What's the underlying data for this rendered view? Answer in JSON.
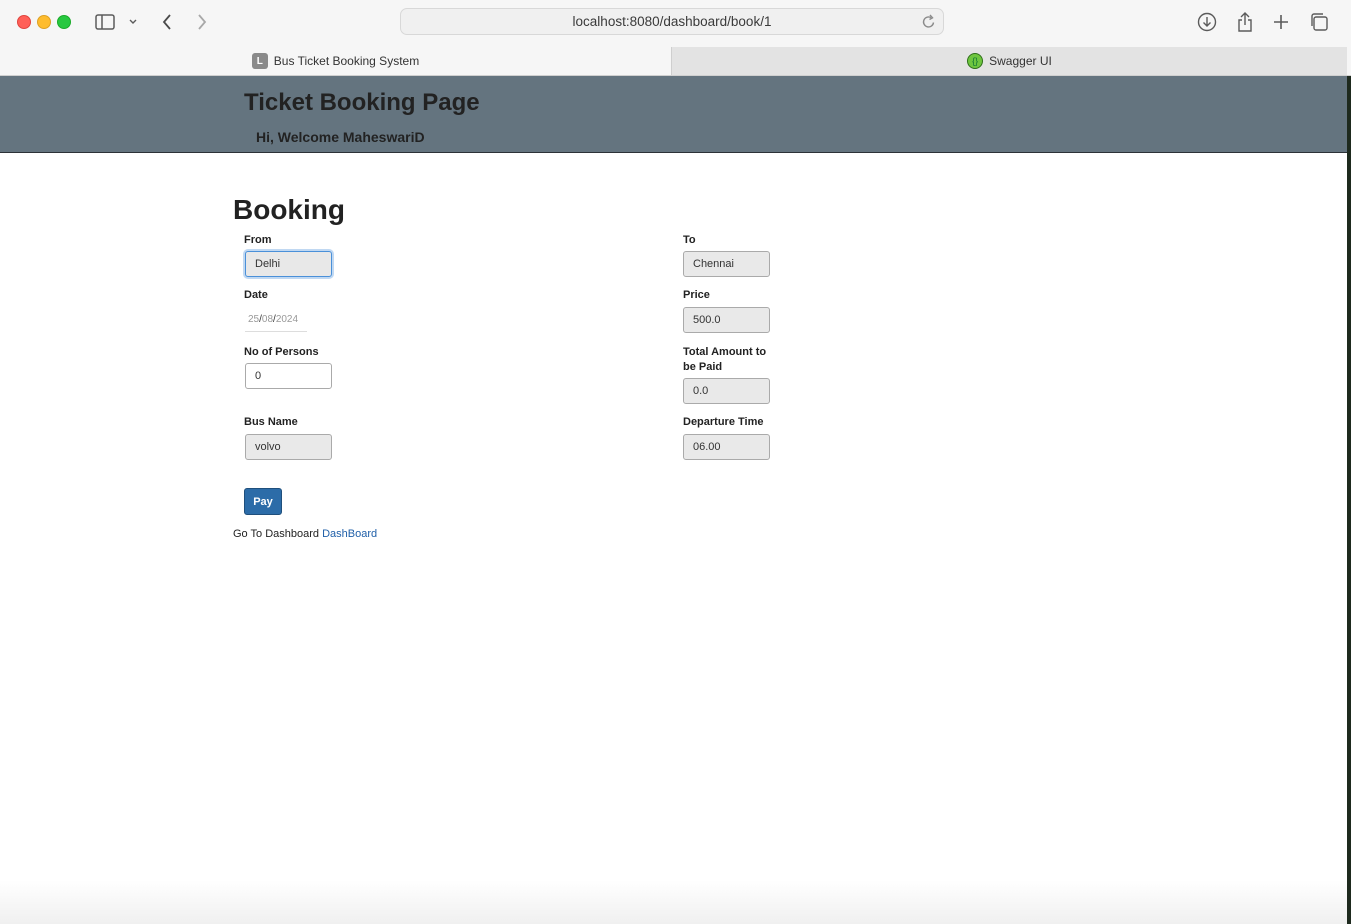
{
  "browser": {
    "url": "localhost:8080/dashboard/book/1",
    "tabs": [
      {
        "label": "Bus Ticket Booking System",
        "icon_letter": "L"
      },
      {
        "label": "Swagger UI"
      }
    ]
  },
  "header": {
    "title": "Ticket Booking Page",
    "welcome": "Hi, Welcome MaheswariD"
  },
  "form": {
    "heading": "Booking",
    "from_label": "From",
    "from_value": "Delhi",
    "to_label": "To",
    "to_value": "Chennai",
    "date_label": "Date",
    "date_day": "25",
    "date_month": "08",
    "date_year": "2024",
    "price_label": "Price",
    "price_value": "500.0",
    "persons_label": "No of Persons",
    "persons_value": "0",
    "total_label_line1": "Total Amount to",
    "total_label_line2": "be Paid",
    "total_value": "0.0",
    "bus_label": "Bus Name",
    "bus_value": "volvo",
    "departure_label": "Departure Time",
    "departure_value": "06.00",
    "pay_label": "Pay"
  },
  "footer": {
    "text": "Go To Dashboard",
    "link": "DashBoard"
  },
  "colors": {
    "header_bg": "#64747f",
    "button": "#2c6ca8",
    "link": "#1f5fa8"
  }
}
